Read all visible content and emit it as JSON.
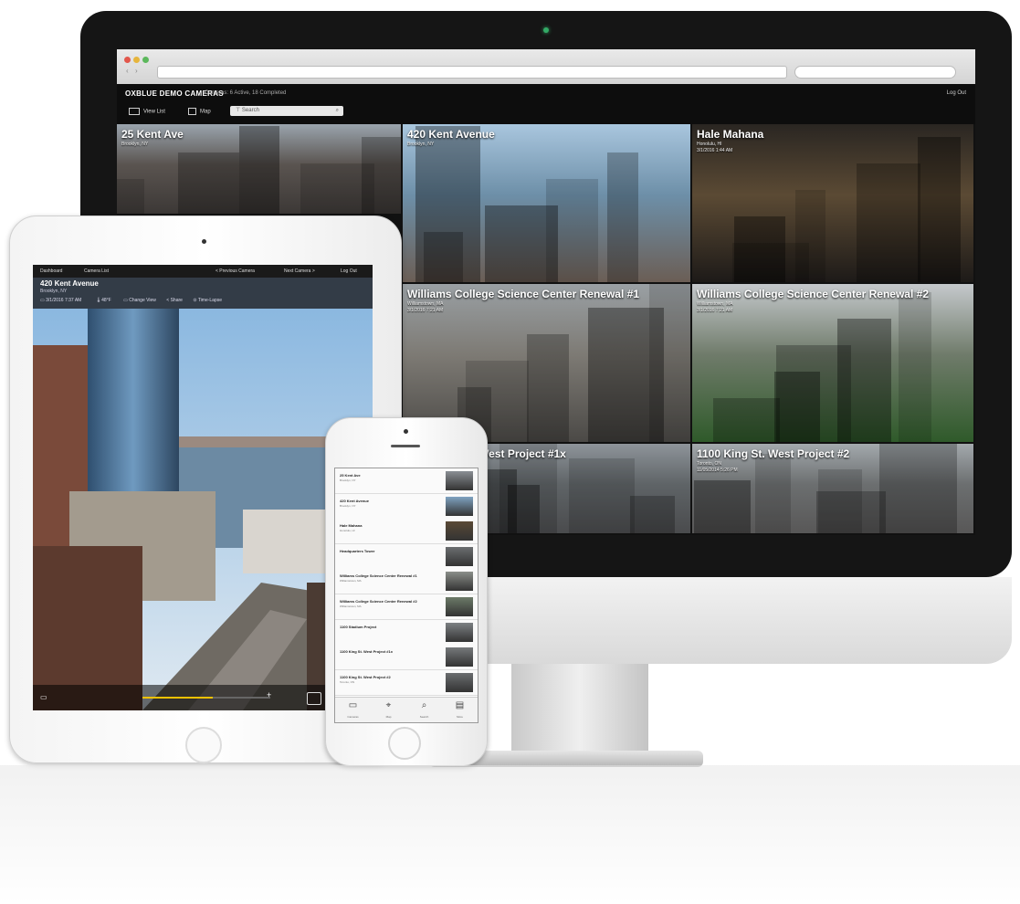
{
  "monitor": {
    "app": {
      "title": "OXBLUE DEMO CAMERAS",
      "status": "Cameras: 6 Active, 18 Completed",
      "logout": "Log Out",
      "toolbar": {
        "view_list": "View List",
        "map": "Map",
        "filter_placeholder": "Search"
      }
    },
    "tiles": [
      {
        "name": "25 Kent Ave",
        "sub1": "Brooklyn, NY",
        "sub2": "",
        "colors": [
          "#9aa4ad",
          "#5a5450",
          "#3c3836"
        ]
      },
      {
        "name": "420 Kent Avenue",
        "sub1": "Brooklyn, NY",
        "sub2": "",
        "colors": [
          "#a9c6de",
          "#6d8fa8",
          "#6b5e55"
        ]
      },
      {
        "name": "Hale Mahana",
        "sub1": "Honolulu, HI",
        "sub2": "3/1/2016 1:44 AM",
        "colors": [
          "#2a2622",
          "#5b4a34",
          "#1d1a18"
        ]
      },
      {
        "name": "Williams College Science Center Renewal #1",
        "sub1": "Williamstown, MA",
        "sub2": "3/1/2016 7:21 AM",
        "colors": [
          "#9aa0a4",
          "#7d7a74",
          "#4b4946"
        ]
      },
      {
        "name": "Williams College Science Center Renewal #2",
        "sub1": "Williamstown, MA",
        "sub2": "3/1/2016 7:21 AM",
        "colors": [
          "#c5c9cc",
          "#6f7b6a",
          "#2f5a2a"
        ]
      },
      {
        "name": "1100 King St. West Project #1x",
        "sub1": "",
        "sub2": "",
        "colors": [
          "#8e949a",
          "#5f6467",
          "#4a4b4d"
        ]
      },
      {
        "name": "1100 King St. West Project #2",
        "sub1": "Toronto, ON",
        "sub2": "11/05/2014 5:26 PM",
        "colors": [
          "#a3a9ad",
          "#6c6f70",
          "#585757"
        ]
      }
    ]
  },
  "ipad": {
    "nav": {
      "dashboard": "Dashboard",
      "camera_list": "Camera List",
      "previous": "< Previous Camera",
      "next": "Next Camera >",
      "logout": "Log Out"
    },
    "camera_name": "420 Kent Avenue",
    "camera_location": "Brooklyn, NY",
    "date": "3/1/2016 7:37 AM",
    "temp": "48°F",
    "change_view": "Change View",
    "share": "Share",
    "time_lapse": "Time-Lapse",
    "timeline_progress": 0.55
  },
  "iphone": {
    "rows": [
      {
        "name": "25 Kent Ave",
        "sub": "Brooklyn, NY"
      },
      {
        "name": "420 Kent Avenue",
        "sub": "Brooklyn, NY"
      },
      {
        "name": "Hale Mahana",
        "sub": "Honolulu, HI"
      },
      {
        "name": "Headquarters Tower",
        "sub": ""
      },
      {
        "name": "Williams College Science Center Renewal #1",
        "sub": "Williamstown, MA"
      },
      {
        "name": "Williams College Science Center Renewal #2",
        "sub": "Williamstown, MA"
      },
      {
        "name": "1100 Stadium Project",
        "sub": ""
      },
      {
        "name": "1100 King St. West Project #1x",
        "sub": ""
      },
      {
        "name": "1100 King St. West Project #2",
        "sub": "Toronto, ON"
      }
    ],
    "tabs": [
      "Cameras",
      "Map",
      "Search",
      "More"
    ]
  }
}
